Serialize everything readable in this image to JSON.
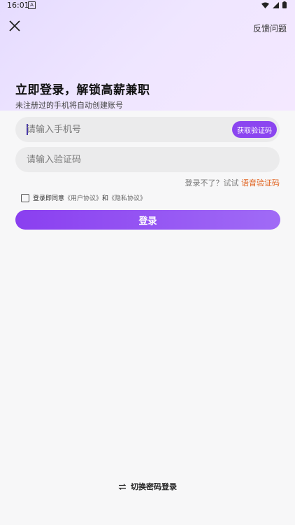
{
  "status_bar": {
    "time": "16:01",
    "notification_icon": "a-badge-icon",
    "icons": [
      "wifi-icon",
      "signal-icon",
      "battery-icon"
    ]
  },
  "header": {
    "close_icon": "close-icon",
    "feedback_label": "反馈问题"
  },
  "hero": {
    "title": "立即登录，解锁高薪兼职",
    "subtitle": "未注册过的手机将自动创建账号"
  },
  "form": {
    "phone_placeholder": "请输入手机号",
    "get_code_label": "获取验证码",
    "code_placeholder": "请输入验证码",
    "voice_prompt": "登录不了？试试",
    "voice_link": "语音验证码",
    "agree_prefix": "登录即同意",
    "user_agreement": "《用户协议》",
    "agree_and": "和",
    "privacy_policy": "《隐私协议》",
    "login_label": "登录"
  },
  "footer": {
    "switch_icon": "swap-icon",
    "switch_label": "切换密码登录"
  },
  "colors": {
    "accent": "#8b45f0",
    "link_orange": "#e0601c",
    "hero_bg": "#ece2ff"
  }
}
